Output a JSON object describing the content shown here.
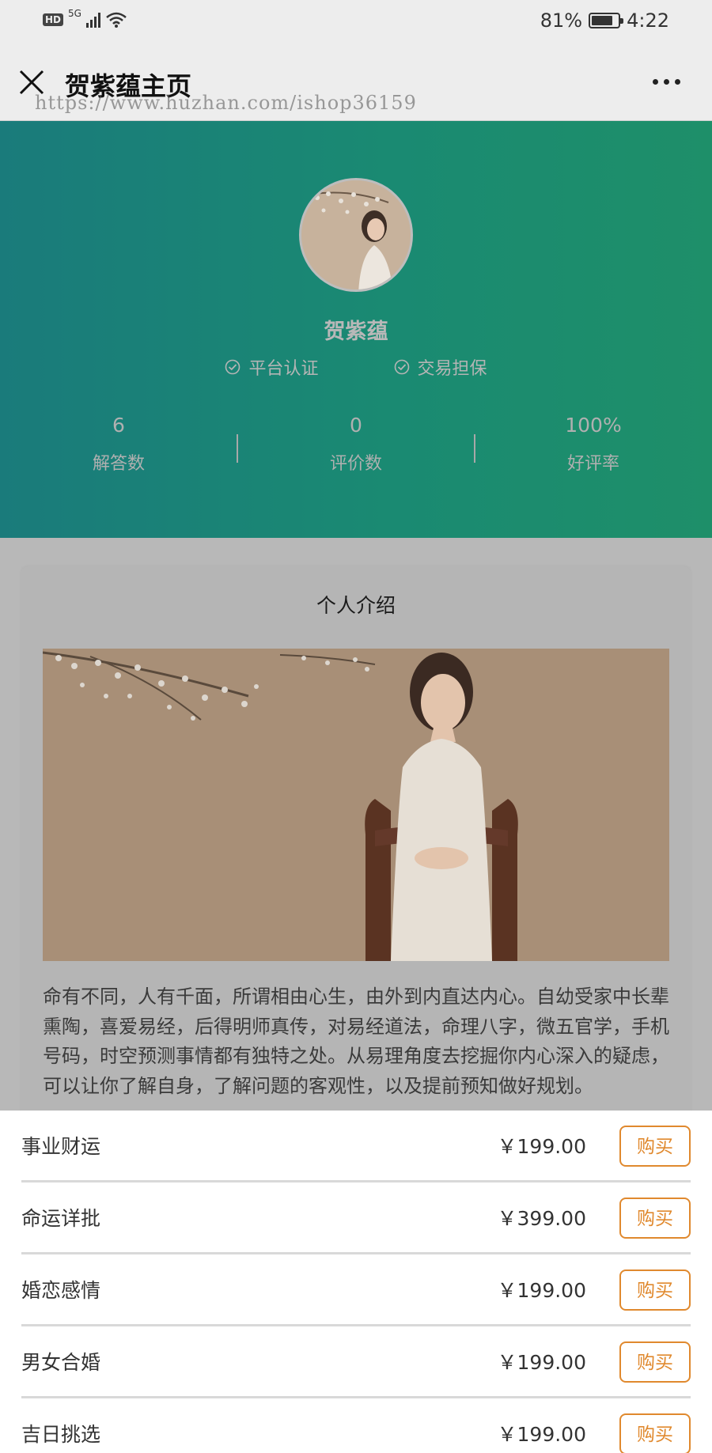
{
  "status_bar": {
    "hd": "HD",
    "network": "5G",
    "battery_percent": "81%",
    "battery_level": 0.81,
    "time": "4:22"
  },
  "title_bar": {
    "title": "贺紫蕴主页",
    "watermark": "https://www.huzhan.com/ishop36159",
    "close_icon": "close-icon",
    "more_icon": "more-icon"
  },
  "profile": {
    "name": "贺紫蕴",
    "badges": [
      {
        "label": "平台认证"
      },
      {
        "label": "交易担保"
      }
    ],
    "stats": [
      {
        "value": "6",
        "label": "解答数"
      },
      {
        "value": "0",
        "label": "评价数"
      },
      {
        "value": "100%",
        "label": "好评率"
      }
    ],
    "gradient_colors": [
      "#1a7b7b",
      "#1e8f69"
    ]
  },
  "intro": {
    "title": "个人介绍",
    "text": "命有不同，人有千面，所谓相由心生，由外到内直达内心。自幼受家中长辈熏陶，喜爱易经，后得明师真传，对易经道法，命理八字，微五官学，手机号码，时空预测事情都有独特之处。从易理角度去挖掘你内心深入的疑虑，可以让你了解自身，了解问题的客观性，以及提前预知做好规划。"
  },
  "products": [
    {
      "name": "事业财运",
      "price": "￥199.00",
      "button": "购买"
    },
    {
      "name": "命运详批",
      "price": "￥399.00",
      "button": "购买"
    },
    {
      "name": "婚恋感情",
      "price": "￥199.00",
      "button": "购买"
    },
    {
      "name": "男女合婚",
      "price": "￥199.00",
      "button": "购买"
    },
    {
      "name": "吉日挑选",
      "price": "￥199.00",
      "button": "购买"
    }
  ],
  "colors": {
    "accent": "#e0892e",
    "hero_teal": "#1a8a72"
  }
}
